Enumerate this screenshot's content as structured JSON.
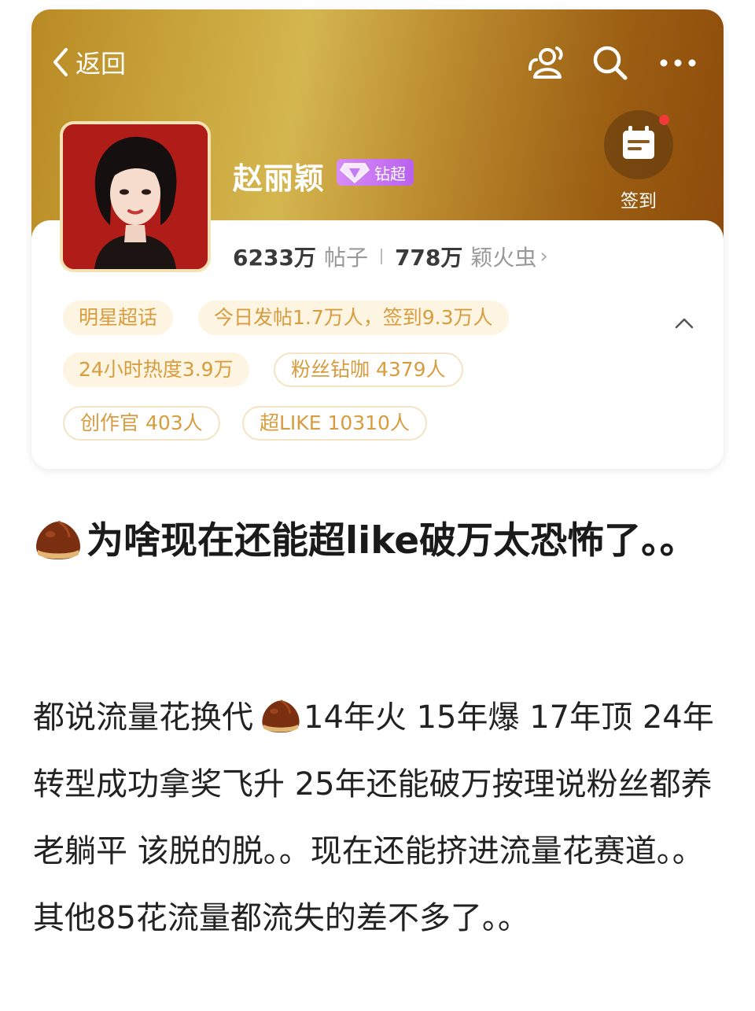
{
  "header": {
    "back_label": "返回"
  },
  "profile": {
    "name": "赵丽颖",
    "badge_label": "钻超",
    "checkin_label": "签到",
    "posts_count": "6233万",
    "posts_label": "帖子",
    "fans_count": "778万",
    "fans_label": "颖火虫",
    "fans_arrow": "›"
  },
  "tags": [
    "明星超话",
    "今日发帖1.7万人，签到9.3万人",
    "24小时热度3.9万",
    "粉丝钻咖 4379人",
    "创作官 403人",
    "超LIKE 10310人"
  ],
  "post": {
    "title": "为啥现在还能超like破万太恐怖了。。",
    "body_part1": "都说流量花换代",
    "body_part2": "14年火 15年爆 17年顶 24年转型成功拿奖飞升 25年还能破万按理说粉丝都养老躺平 该脱的脱。。现在还能挤进流量花赛道。。其他85花流量都流失的差不多了。。"
  },
  "colors": {
    "banner_gold": "#c9a43c",
    "banner_bronze": "#8e4a0b",
    "tag_text": "#d79c3e",
    "badge_purple": "#b962ee"
  },
  "icons": [
    "chevron-left-icon",
    "friends-icon",
    "search-icon",
    "more-icon",
    "calendar-icon",
    "diamond-icon",
    "chevron-up-icon",
    "chestnut-icon"
  ]
}
